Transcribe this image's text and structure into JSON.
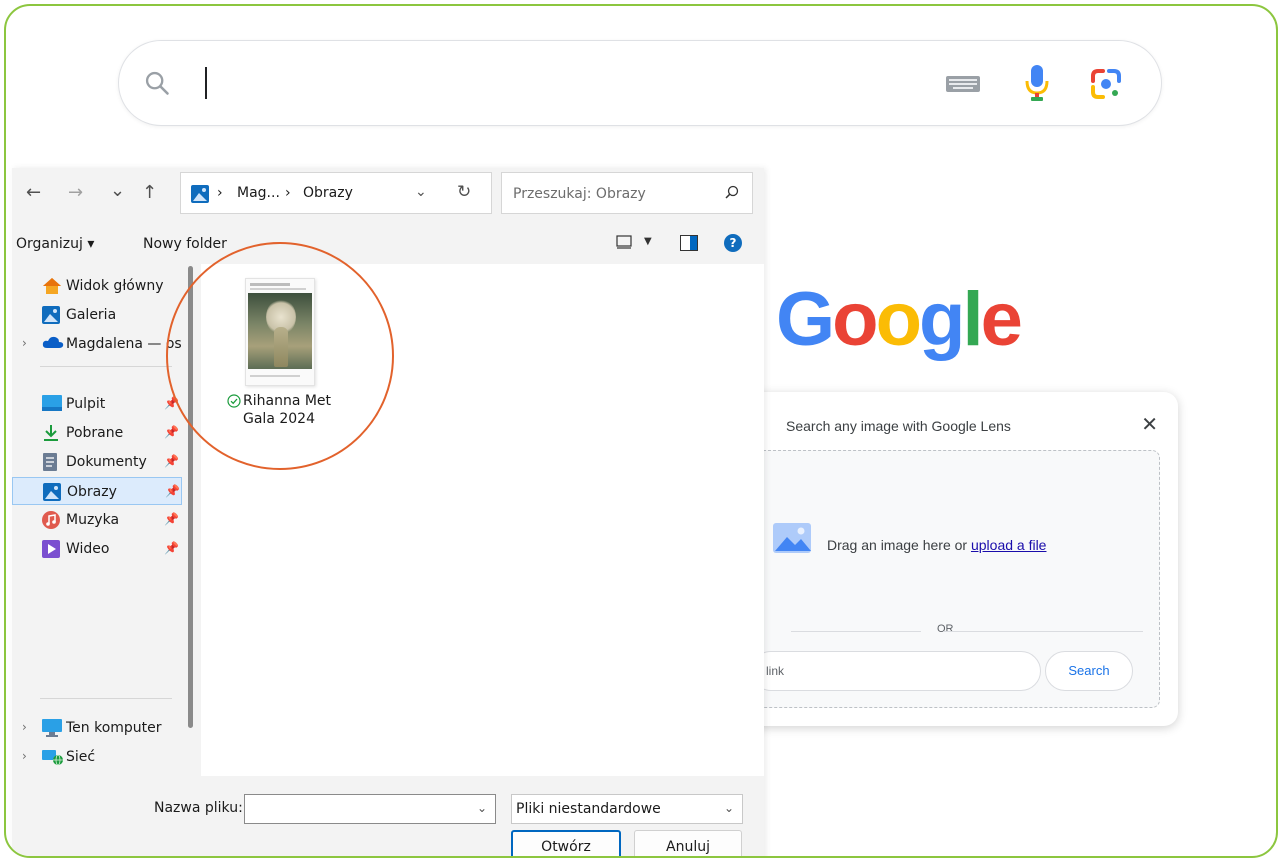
{
  "google": {
    "logo_letters": [
      "G",
      "o",
      "o",
      "g",
      "l",
      "e"
    ],
    "logo_colors": [
      "#4285F4",
      "#EA4335",
      "#FBBC05",
      "#4285F4",
      "#34A853",
      "#EA4335"
    ],
    "lens_panel": {
      "title": "Search any image with Google Lens",
      "close": "✕",
      "drop_text": "Drag an image here or ",
      "upload_link": "upload a file",
      "or_text": "OR",
      "link_placeholder": "link",
      "search_button": "Search"
    }
  },
  "dialog": {
    "nav": {
      "back": "←",
      "forward": "→",
      "recent": "⌄",
      "up": "↑"
    },
    "breadcrumb": [
      "Mag...",
      "Obrazy"
    ],
    "crumb_sep": "›",
    "refresh": "↻",
    "search_placeholder": "Przeszukaj: Obrazy",
    "toolbar": {
      "organize": "Organizuj ▾",
      "new_folder": "Nowy folder",
      "help": "?"
    },
    "nav_items": [
      {
        "label": "Widok główny",
        "icon": "home-icon"
      },
      {
        "label": "Galeria",
        "icon": "gallery-icon"
      },
      {
        "label": "Magdalena — osobiste",
        "icon": "onedrive-cloud-icon"
      },
      {
        "label": "Pulpit",
        "icon": "desktop-icon",
        "pinned": true
      },
      {
        "label": "Pobrane",
        "icon": "download-icon",
        "pinned": true
      },
      {
        "label": "Dokumenty",
        "icon": "documents-icon",
        "pinned": true
      },
      {
        "label": "Obrazy",
        "icon": "pictures-icon",
        "pinned": true,
        "selected": true
      },
      {
        "label": "Muzyka",
        "icon": "music-icon",
        "pinned": true
      },
      {
        "label": "Wideo",
        "icon": "video-icon",
        "pinned": true
      },
      {
        "label": "Ten komputer",
        "icon": "computer-icon"
      },
      {
        "label": "Sieć",
        "icon": "network-icon"
      }
    ],
    "files": [
      {
        "name": "Rihanna Met Gala 2024",
        "status": "synced"
      }
    ],
    "filename_label": "Nazwa pliku:",
    "filename_value": "",
    "filetype": "Pliki niestandardowe",
    "open_button": "Otwórz",
    "cancel_button": "Anuluj"
  }
}
